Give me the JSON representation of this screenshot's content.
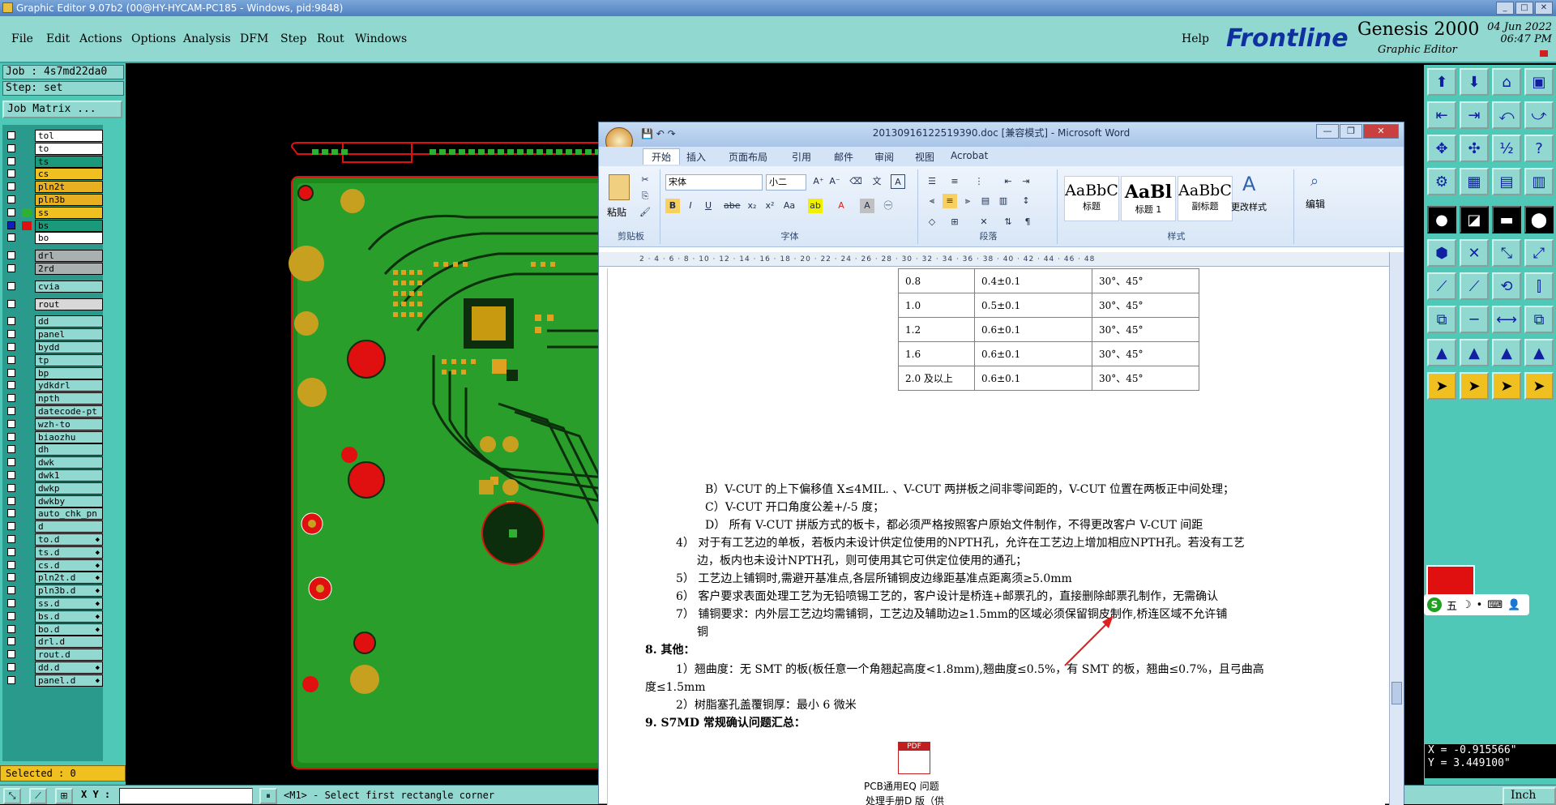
{
  "window": {
    "title": "Graphic Editor 9.07b2 (00@HY-HYCAM-PC185 - Windows, pid:9848)"
  },
  "menu": [
    "File",
    "Edit",
    "Actions",
    "Options",
    "Analysis",
    "DFM",
    "Step",
    "Rout",
    "Windows"
  ],
  "help": "Help",
  "brand": {
    "logo": "Frontline",
    "product": "Genesis 2000",
    "subtitle": "Graphic Editor",
    "date": "04 Jun 2022",
    "time": "06:47 PM"
  },
  "job": {
    "job_line": "Job : 4s7md22da0",
    "step_line": "Step: set",
    "matrix_button": "Job Matrix ..."
  },
  "layers": [
    {
      "name": "tol",
      "color": "#ffffff",
      "sw": "#2a9a8c"
    },
    {
      "name": "to",
      "color": "#ffffff",
      "sw": "#2a9a8c"
    },
    {
      "name": "ts",
      "color": "#1a9a7a",
      "sw": "#2a9a8c"
    },
    {
      "name": "cs",
      "color": "#f0c020",
      "sw": "#2a9a8c"
    },
    {
      "name": "pln2t",
      "color": "#e8b020",
      "sw": "#2a9a8c"
    },
    {
      "name": "pln3b",
      "color": "#e8b020",
      "sw": "#2a9a8c"
    },
    {
      "name": "ss",
      "color": "#f0c020",
      "sw": "#30b030"
    },
    {
      "name": "bs",
      "color": "#1a9a7a",
      "sw": "#e01010"
    },
    {
      "name": "bo",
      "color": "#ffffff",
      "sw": "#2a9a8c"
    },
    {
      "name": "drl",
      "color": "#a8b0b0",
      "sw": "#2a9a8c"
    },
    {
      "name": "2rd",
      "color": "#a8b0b0",
      "sw": "#2a9a8c"
    },
    {
      "name": "cvia",
      "color": "#90d8d0",
      "sw": "#2a9a8c"
    },
    {
      "name": "rout",
      "color": "#d8d8d8",
      "sw": "#2a9a8c"
    },
    {
      "name": "dd",
      "color": "#90d8d0",
      "sw": "#2a9a8c"
    },
    {
      "name": "panel",
      "color": "#90d8d0",
      "sw": "#2a9a8c"
    },
    {
      "name": "bydd",
      "color": "#90d8d0",
      "sw": "#2a9a8c"
    },
    {
      "name": "tp",
      "color": "#90d8d0",
      "sw": "#2a9a8c"
    },
    {
      "name": "bp",
      "color": "#90d8d0",
      "sw": "#2a9a8c"
    },
    {
      "name": "ydkdrl",
      "color": "#90d8d0",
      "sw": "#2a9a8c"
    },
    {
      "name": "npth",
      "color": "#90d8d0",
      "sw": "#2a9a8c"
    },
    {
      "name": "datecode-pt",
      "color": "#90d8d0",
      "sw": "#2a9a8c"
    },
    {
      "name": "wzh-to",
      "color": "#90d8d0",
      "sw": "#2a9a8c"
    },
    {
      "name": "biaozhu",
      "color": "#90d8d0",
      "sw": "#2a9a8c"
    },
    {
      "name": "dh",
      "color": "#90d8d0",
      "sw": "#2a9a8c"
    },
    {
      "name": "dwk",
      "color": "#90d8d0",
      "sw": "#2a9a8c"
    },
    {
      "name": "dwk1",
      "color": "#90d8d0",
      "sw": "#2a9a8c"
    },
    {
      "name": "dwkp",
      "color": "#90d8d0",
      "sw": "#2a9a8c"
    },
    {
      "name": "dwkby",
      "color": "#90d8d0",
      "sw": "#2a9a8c"
    },
    {
      "name": "auto_chk_pn",
      "color": "#90d8d0",
      "sw": "#2a9a8c"
    },
    {
      "name": "d",
      "color": "#90d8d0",
      "sw": "#2a9a8c"
    },
    {
      "name": "to.d",
      "color": "#90d8d0",
      "sw": "#2a9a8c",
      "arrow": "◆"
    },
    {
      "name": "ts.d",
      "color": "#90d8d0",
      "sw": "#2a9a8c",
      "arrow": "◆"
    },
    {
      "name": "cs.d",
      "color": "#90d8d0",
      "sw": "#2a9a8c",
      "arrow": "◆"
    },
    {
      "name": "pln2t.d",
      "color": "#90d8d0",
      "sw": "#2a9a8c",
      "arrow": "◆"
    },
    {
      "name": "pln3b.d",
      "color": "#90d8d0",
      "sw": "#2a9a8c",
      "arrow": "◆"
    },
    {
      "name": "ss.d",
      "color": "#90d8d0",
      "sw": "#2a9a8c",
      "arrow": "◆"
    },
    {
      "name": "bs.d",
      "color": "#90d8d0",
      "sw": "#2a9a8c",
      "arrow": "◆"
    },
    {
      "name": "bo.d",
      "color": "#90d8d0",
      "sw": "#2a9a8c",
      "arrow": "◆"
    },
    {
      "name": "drl.d",
      "color": "#90d8d0",
      "sw": "#2a9a8c"
    },
    {
      "name": "rout.d",
      "color": "#90d8d0",
      "sw": "#2a9a8c"
    },
    {
      "name": "dd.d",
      "color": "#90d8d0",
      "sw": "#2a9a8c",
      "arrow": "◆"
    },
    {
      "name": "panel.d",
      "color": "#90d8d0",
      "sw": "#2a9a8c",
      "arrow": "◆"
    }
  ],
  "selected": "Selected : 0",
  "status": {
    "xy_label": "X Y :",
    "xy_value": "",
    "prompt": "<M1> - Select first rectangle corner",
    "units": "Inch"
  },
  "coords": {
    "x": "X = -0.915566\"",
    "y": "Y = 3.449100\""
  },
  "word": {
    "title": "20130916122519390.doc [兼容模式] - Microsoft Word",
    "tabs": [
      "开始",
      "插入",
      "页面布局",
      "引用",
      "邮件",
      "审阅",
      "视图",
      "Acrobat"
    ],
    "font_name": "宋体",
    "font_size": "小二",
    "groups": {
      "clipboard": "剪贴板",
      "paste": "粘贴",
      "font": "字体",
      "paragraph": "段落",
      "styles": "样式",
      "change_styles": "更改样式",
      "edit": "编辑"
    },
    "styles": [
      {
        "sample": "AaBbC",
        "name": "标题"
      },
      {
        "sample": "AaBl",
        "name": "标题 1"
      },
      {
        "sample": "AaBbC",
        "name": "副标题"
      }
    ],
    "ruler": "2 · 4 · 6 · 8 · 10 · 12 · 14 · 16 · 18 · 20 · 22 · 24 · 26 · 28 · 30 · 32 · 34 · 36 · 38 · 40 · 42 · 44 · 46 · 48",
    "table_rows": [
      [
        "0.8",
        "0.4±0.1",
        "30°、45°"
      ],
      [
        "1.0",
        "0.5±0.1",
        "30°、45°"
      ],
      [
        "1.2",
        "0.6±0.1",
        "30°、45°"
      ],
      [
        "1.6",
        "0.6±0.1",
        "30°、45°"
      ],
      [
        "2.0 及以上",
        "0.6±0.1",
        "30°、45°"
      ]
    ],
    "lines": {
      "b": "B）V-CUT 的上下偏移值 X≤4MIL. 、V-CUT 两拼板之间非零间距的，V-CUT 位置在两板正中间处理；",
      "c": "C）V-CUT 开口角度公差+/-5 度；",
      "d": "D） 所有 V-CUT 拼版方式的板卡，都必须严格按照客户原始文件制作，不得更改客户 V-CUT 间距",
      "i4a": "4） 对于有工艺边的单板，若板内未设计供定位使用的NPTH孔，允许在工艺边上增加相应NPTH孔。若没有工艺",
      "i4b": "边，板内也未设计NPTH孔，则可使用其它可供定位使用的通孔；",
      "i5": "5） 工艺边上铺铜时,需避开基准点,各层所铺铜皮边缘距基准点距离须≥5.0mm",
      "i6": "6） 客户要求表面处理工艺为无铅喷锡工艺的，客户设计是桥连+邮票孔的，直接删除邮票孔制作，无需确认",
      "i7a": "7） 铺铜要求：内外层工艺边均需铺铜，工艺边及辅助边≥1.5mm的区域必须保留铜皮制作,桥连区域不允许铺",
      "i7b": "铜",
      "h8": "8.  其他：",
      "w1a": "1）翘曲度：无 SMT 的板(板任意一个角翘起高度<1.8mm),翘曲度≤0.5%，有 SMT 的板，翘曲≤0.7%，且弓曲高",
      "w1b": "度≤1.5mm",
      "w2": "2）树脂塞孔盖覆铜厚：最小 6 微米",
      "h9": "9.  S7MD 常规确认问题汇总：",
      "att1": "PCB通用EQ 问题",
      "att2": "处理手册D 版（供"
    }
  },
  "ime": [
    "五",
    "☽",
    "•",
    "⌨",
    "👤",
    "✿"
  ]
}
